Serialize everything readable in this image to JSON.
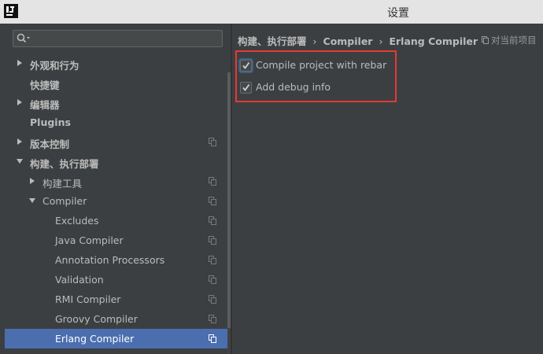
{
  "window": {
    "title": "设置"
  },
  "search": {
    "placeholder": "",
    "value": ""
  },
  "tree": [
    {
      "label": "外观和行为",
      "bold": true,
      "arrow": "right",
      "project": false
    },
    {
      "label": "快捷键",
      "bold": true,
      "arrow": "",
      "project": false
    },
    {
      "label": "编辑器",
      "bold": true,
      "arrow": "right",
      "project": false
    },
    {
      "label": "Plugins",
      "bold": true,
      "arrow": "",
      "project": false
    },
    {
      "label": "版本控制",
      "bold": true,
      "arrow": "right",
      "project": true
    },
    {
      "label": "构建、执行部署",
      "bold": true,
      "arrow": "down",
      "project": false
    },
    {
      "label": "构建工具",
      "bold": false,
      "arrow": "right",
      "project": true
    },
    {
      "label": "Compiler",
      "bold": false,
      "arrow": "down",
      "project": true
    },
    {
      "label": "Excludes",
      "bold": false,
      "arrow": "",
      "project": true
    },
    {
      "label": "Java Compiler",
      "bold": false,
      "arrow": "",
      "project": true
    },
    {
      "label": "Annotation Processors",
      "bold": false,
      "arrow": "",
      "project": true
    },
    {
      "label": "Validation",
      "bold": false,
      "arrow": "",
      "project": true
    },
    {
      "label": "RMI Compiler",
      "bold": false,
      "arrow": "",
      "project": true
    },
    {
      "label": "Groovy Compiler",
      "bold": false,
      "arrow": "",
      "project": true
    },
    {
      "label": "Erlang Compiler",
      "bold": false,
      "arrow": "",
      "project": true,
      "selected": true
    }
  ],
  "breadcrumb": {
    "items": [
      "构建、执行部署",
      "Compiler",
      "Erlang Compiler"
    ],
    "separator": "›",
    "scope_label": "对当前项目"
  },
  "options": [
    {
      "label": "Compile project with rebar",
      "checked": true
    },
    {
      "label": "Add debug info",
      "checked": true
    }
  ],
  "colors": {
    "background": "#3c3f41",
    "selection": "#4b6eaf",
    "highlight_border": "#e53935",
    "titlebar": "#e4e4e4"
  }
}
